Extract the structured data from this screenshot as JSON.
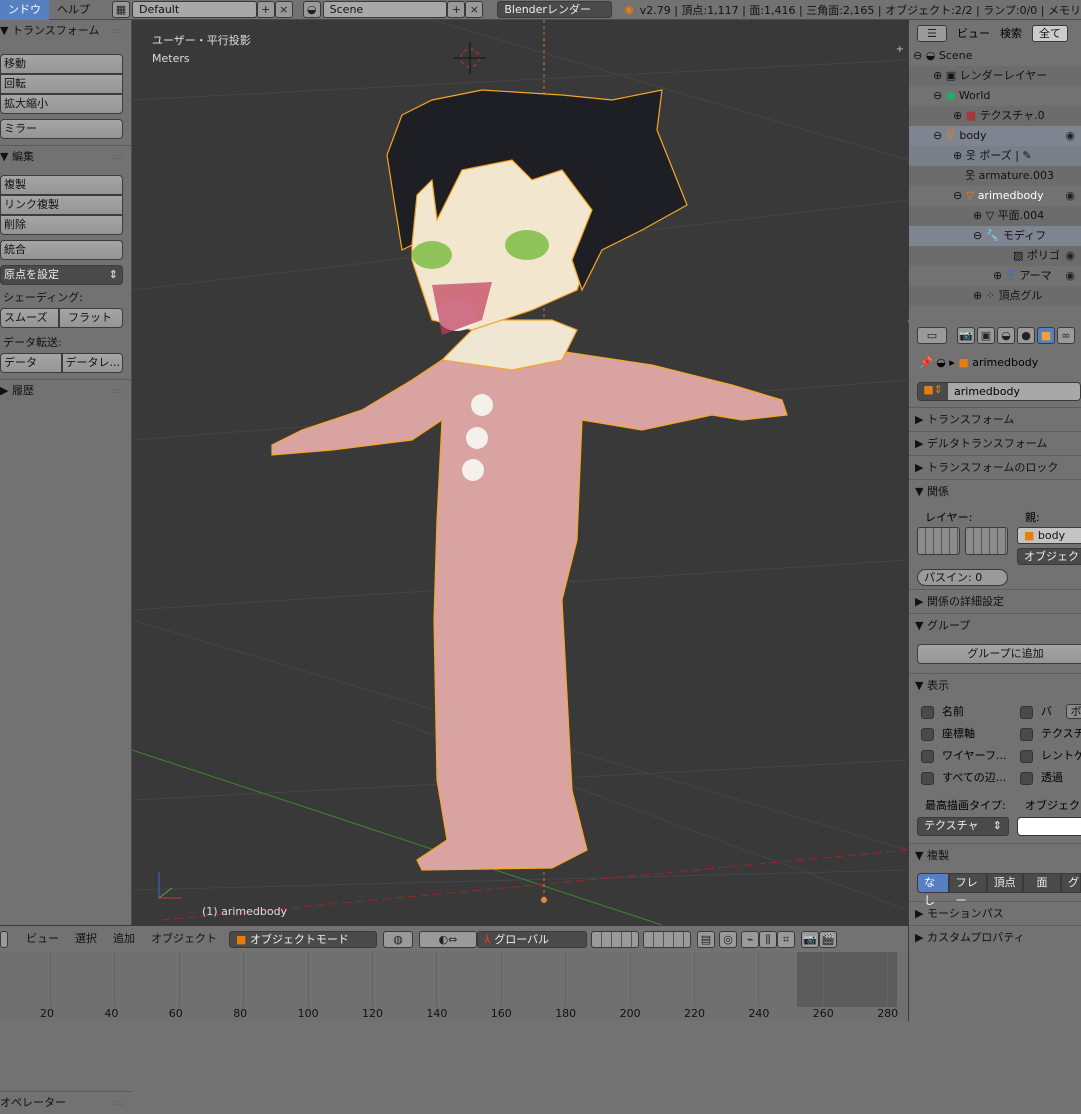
{
  "topbar": {
    "menus": [
      "ンドウ",
      "ヘルプ"
    ],
    "screen_layout": "Default",
    "scene": "Scene",
    "render_engine": "Blenderレンダー",
    "stats": "v2.79 | 頂点:1,117 | 面:1,416 | 三角面:2,165 | オブジェクト:2/2 | ランプ:0/0 | メモリ"
  },
  "toolshelf": {
    "transform": {
      "title": "トランスフォーム",
      "buttons": [
        "移動",
        "回転",
        "拡大縮小"
      ],
      "mirror": "ミラー"
    },
    "edit": {
      "title": "編集",
      "buttons": [
        "複製",
        "リンク複製",
        "削除"
      ],
      "join": "統合",
      "set_origin": "原点を設定",
      "shading_label": "シェーディング:",
      "smooth": "スムーズ",
      "flat": "フラット",
      "data_transfer_label": "データ転送:",
      "data": "データ",
      "data_layers": "データレ..."
    },
    "history": {
      "title": "履歴"
    },
    "operator": {
      "title": "オペレーター"
    }
  },
  "viewport": {
    "view_name": "ユーザー・平行投影",
    "units": "Meters",
    "active_object": "(1) arimedbody"
  },
  "outliner": {
    "view": "ビュー",
    "search": "検索",
    "filter": "全て",
    "items": [
      {
        "label": "Scene",
        "icon": "scene-icon"
      },
      {
        "label": "レンダーレイヤー",
        "icon": "render-layer-icon"
      },
      {
        "label": "World",
        "icon": "world-icon"
      },
      {
        "label": "テクスチャ.0",
        "icon": "texture-icon"
      },
      {
        "label": "body",
        "icon": "armature-icon"
      },
      {
        "label": "ポーズ",
        "icon": "pose-icon"
      },
      {
        "label": "armature.003",
        "icon": "armature-data-icon"
      },
      {
        "label": "arimedbody",
        "icon": "mesh-icon"
      },
      {
        "label": "平面.004",
        "icon": "mesh-data-icon"
      },
      {
        "label": "モディフ",
        "icon": "wrench-icon"
      },
      {
        "label": "ポリゴ",
        "icon": "modifier-icon"
      },
      {
        "label": "アーマ",
        "icon": "armature-icon"
      },
      {
        "label": "頂点グル",
        "icon": "vertex-group-icon"
      }
    ]
  },
  "properties": {
    "breadcrumb": "arimedbody",
    "object_name": "arimedbody",
    "panels": {
      "transform": "トランスフォーム",
      "delta": "デルタトランスフォーム",
      "lock": "トランスフォームのロック",
      "relations": "関係",
      "relations_extra": "関係の詳細設定",
      "groups": "グループ",
      "display": "表示",
      "duplication": "複製",
      "motion_paths": "モーションパス",
      "custom_props": "カスタムプロパティ"
    },
    "relations": {
      "layer_label": "レイヤー:",
      "parent_label": "親:",
      "parent": "body",
      "parent_type": "オブジェク",
      "pass_index": "パスイン: 0"
    },
    "groups": {
      "add": "グループに追加"
    },
    "display": {
      "checks": [
        "名前",
        "座標軸",
        "ワイヤーフ...",
        "すべての辺...",
        "バ",
        "テクスチ",
        "レントゲ",
        "透過"
      ],
      "bounds_btn": "ボ",
      "max_draw_label": "最高描画タイプ:",
      "max_draw": "テクスチャ",
      "obj_color_label": "オブジェク"
    },
    "duplication": {
      "options": [
        "なし",
        "フレー",
        "頂点",
        "面",
        "グ"
      ],
      "selected": "なし"
    }
  },
  "bottom_header": {
    "menus": [
      "ビュー",
      "選択",
      "追加",
      "オブジェクト"
    ],
    "mode": "オブジェクトモード",
    "orientation": "グローバル"
  },
  "timeline": {
    "ticks": [
      20,
      40,
      60,
      80,
      100,
      120,
      140,
      160,
      180,
      200,
      220,
      240,
      260,
      280
    ]
  },
  "colors": {
    "accent": "#5680c2",
    "selection": "#f5a623",
    "viewport_bg": "#393939"
  }
}
